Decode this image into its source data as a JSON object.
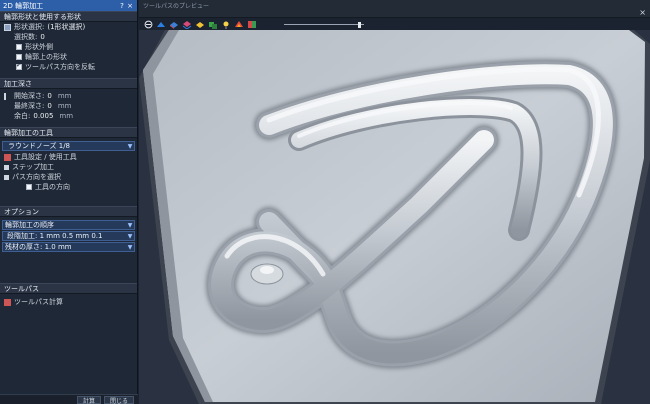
{
  "panel": {
    "title": "2D 輪郭加工",
    "title_buttons": [
      "?",
      "×"
    ],
    "sections": {
      "geometry": {
        "header": "輪郭形状と使用する形状",
        "rows": [
          {
            "label": "形状選択:",
            "value": "(1形状選択)"
          },
          {
            "label": "選択数:",
            "value": "0"
          }
        ],
        "checks": [
          {
            "label": "形状外側",
            "checked": false
          },
          {
            "label": "輪郭上の形状",
            "checked": false
          },
          {
            "label": "ツールパス方向を反転",
            "checked": true
          }
        ]
      },
      "depth": {
        "header": "加工深さ",
        "rows": [
          {
            "label": "開始深さ:",
            "value": "0",
            "unit": "mm"
          },
          {
            "label": "最終深さ:",
            "value": "0",
            "unit": "mm"
          },
          {
            "label": "余白:",
            "value": "0.005",
            "unit": "mm"
          }
        ]
      },
      "tool": {
        "header": "輪郭加工の工具",
        "dropdown": "ラウンドノーズ 1/8",
        "items": [
          "工具設定 / 使用工具",
          "ステップ加工",
          "パス方向を選択"
        ],
        "subitem": "工具の方向"
      },
      "options": {
        "header": "オプション",
        "dropdowns": [
          "輪郭加工の順序",
          "段階加工: 1 mm 0.5 mm 0.1",
          "残材の厚さ: 1.0 mm"
        ]
      },
      "calc": {
        "header": "ツールパス",
        "item": "ツールパス計算"
      }
    },
    "footer_buttons": [
      "計算",
      "閉じる"
    ]
  },
  "viewport": {
    "title": "ツールパスのプレビュー",
    "close": "×"
  },
  "colors": {
    "accent": "#2d5fa8",
    "panel_bg": "#1f2836",
    "model_surface": "#c5ccd3"
  }
}
